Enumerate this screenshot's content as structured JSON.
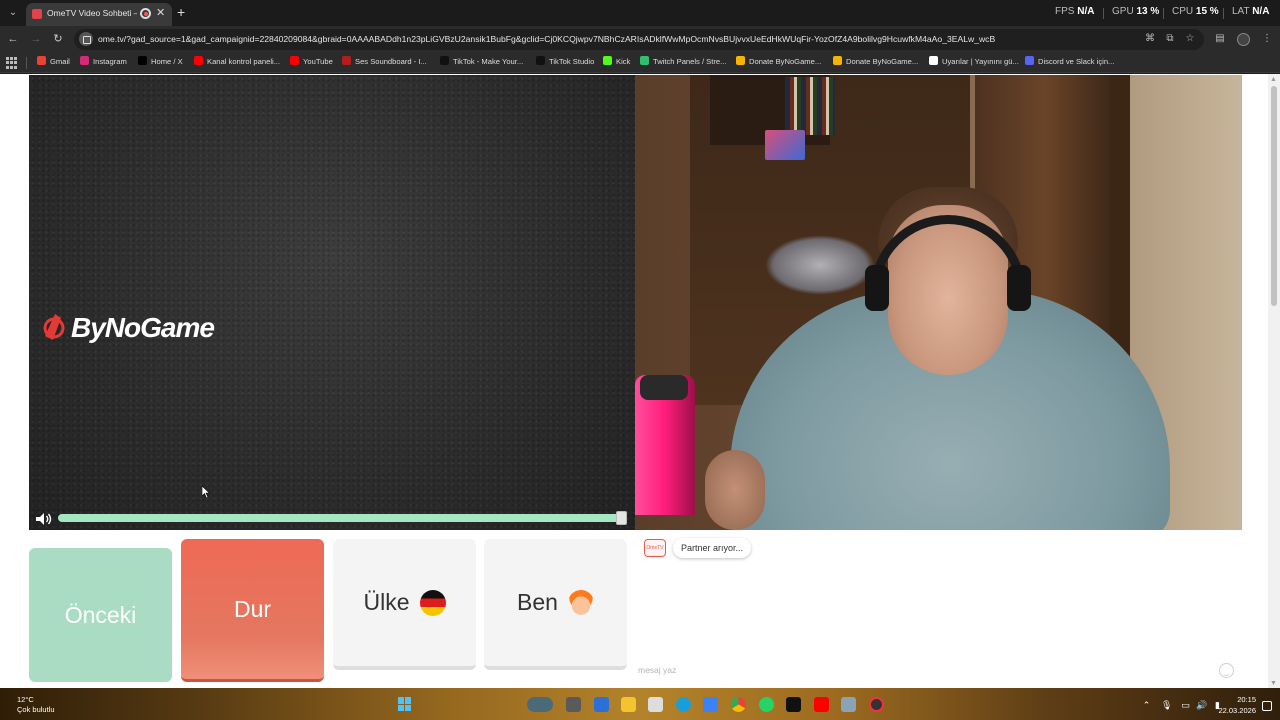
{
  "browser": {
    "tab_title": "OmeTV Video Sohbeti — O",
    "url": "ome.tv/?gad_source=1&gad_campaignid=22840209084&gbraid=0AAAABADdh1n23pLiGVBzU2ansik1BubFg&gclid=Cj0KCQjwpv7NBhCzARIsADklfWwMpOcmNvsBUjvvxUeEdHkWUqFir-YozOfZ4A9bolilvg9HcuwfkM4aAo_3EALw_wcB",
    "perf": {
      "fps_label": "FPS",
      "fps_value": "N/A",
      "gpu_label": "GPU",
      "gpu_value": "13 %",
      "cpu_label": "CPU",
      "cpu_value": "15 %",
      "lat_label": "LAT",
      "lat_value": "N/A"
    },
    "bookmarks": [
      {
        "label": "Gmail",
        "color": "#ea4335"
      },
      {
        "label": "Instagram",
        "color": "#d62976"
      },
      {
        "label": "Home / X",
        "color": "#000000"
      },
      {
        "label": "Kanal kontrol paneli...",
        "color": "#ff0000"
      },
      {
        "label": "YouTube",
        "color": "#ff0000"
      },
      {
        "label": "Ses Soundboard - I...",
        "color": "#b71c1c"
      },
      {
        "label": "TikTok - Make Your...",
        "color": "#111111"
      },
      {
        "label": "TikTok Studio",
        "color": "#111111"
      },
      {
        "label": "Kick",
        "color": "#53fc18"
      },
      {
        "label": "Twitch Panels / Stre...",
        "color": "#2fbf71"
      },
      {
        "label": "Donate ByNoGame...",
        "color": "#f5b400"
      },
      {
        "label": "Donate ByNoGame...",
        "color": "#f5b400"
      },
      {
        "label": "Uyarılar | Yayınını gü...",
        "color": "#ffffff"
      },
      {
        "label": "Discord ve Slack için...",
        "color": "#5865f2"
      }
    ]
  },
  "stream": {
    "logo_text": "ByNoGame",
    "volume_percent": 100
  },
  "controls": {
    "prev_label": "Önceki",
    "stop_label": "Dur",
    "country_label": "Ülke",
    "me_label": "Ben"
  },
  "chat": {
    "logo_text": "OmeTV",
    "status_message": "Partner arıyor...",
    "input_placeholder": "mesaj yaz"
  },
  "taskbar": {
    "temperature": "12°C",
    "weather": "Çok bulutlu",
    "time": "20:15",
    "date": "22.03.2026"
  },
  "colors": {
    "prev_button": "#a9dcc3",
    "stop_button": "#ee6a55",
    "volume_fill": "#a6e7c3",
    "accent": "#e45a4a"
  }
}
